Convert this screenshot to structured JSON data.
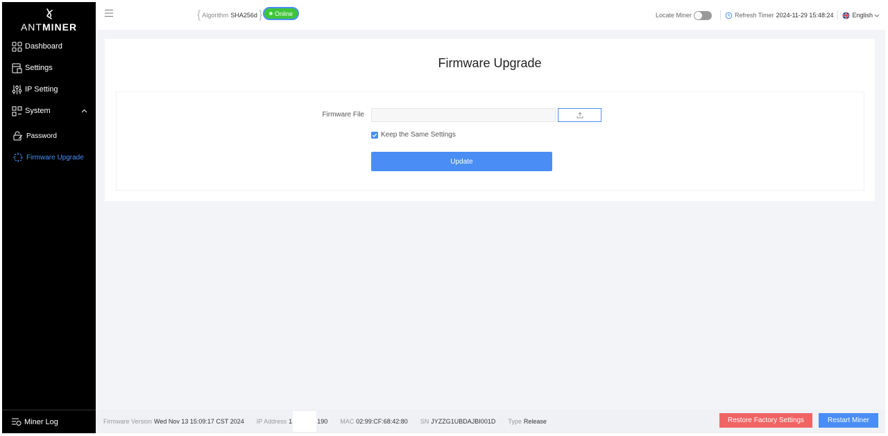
{
  "brand": {
    "logo_prefix": "ANT",
    "logo_suffix": "MINER"
  },
  "sidebar": {
    "items": [
      {
        "label": "Dashboard",
        "icon": "dashboard-icon"
      },
      {
        "label": "Settings",
        "icon": "settings-icon"
      },
      {
        "label": "IP Setting",
        "icon": "sliders-icon"
      },
      {
        "label": "System",
        "icon": "system-icon"
      },
      {
        "label": "Password",
        "icon": "password-icon"
      },
      {
        "label": "Firmware Upgrade",
        "icon": "firmware-icon",
        "active": true
      }
    ],
    "bottom_label": "Miner Log"
  },
  "header": {
    "algorithm_label": "Algorithm",
    "algorithm_value": "SHA256d",
    "status": "Online",
    "locate_label": "Locate Miner",
    "refresh_label": "Refresh Timer",
    "refresh_value": "2024-11-29 15:48:24",
    "language": "English"
  },
  "main": {
    "title": "Firmware Upgrade",
    "file_label": "Firmware File",
    "file_value": "",
    "keep_label": "Keep the Same Settings",
    "keep_checked": true,
    "update_label": "Update"
  },
  "footer": {
    "fw_label": "Firmware Version",
    "fw_value": "Wed Nov 13 15:09:17 CST 2024",
    "ip_label": "IP Address",
    "ip_prefix": "1",
    "ip_suffix": "190",
    "mac_label": "MAC",
    "mac_value": "02:99:CF:68:42:80",
    "sn_label": "SN",
    "sn_value": "JYZZG1UBDAJBI001D",
    "type_label": "Type",
    "type_value": "Release",
    "restore_label": "Restore Factory Settings",
    "restart_label": "Restart Miner"
  },
  "colors": {
    "accent": "#4a8ef5",
    "online": "#3ec53a",
    "danger": "#f06464",
    "sidebar": "#000000"
  }
}
